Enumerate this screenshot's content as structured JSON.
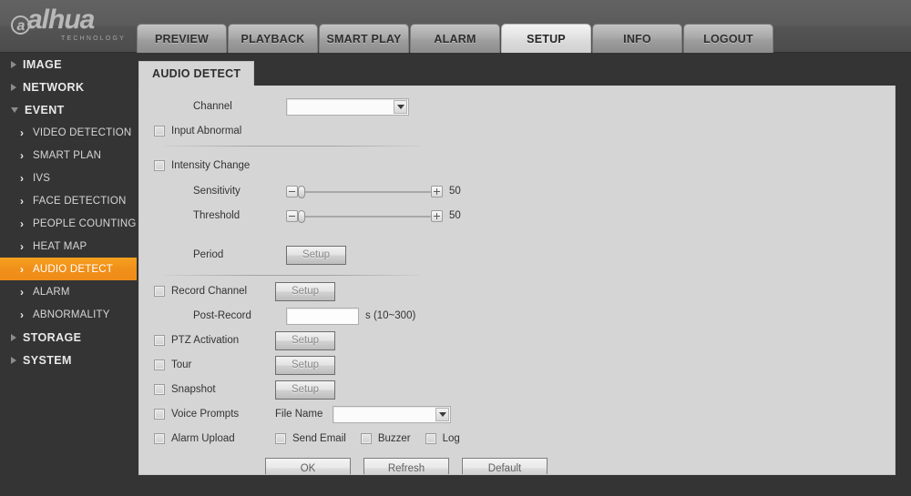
{
  "brand": {
    "name": "alhua",
    "tagline": "TECHNOLOGY"
  },
  "nav": {
    "tabs": [
      {
        "label": "PREVIEW",
        "active": false
      },
      {
        "label": "PLAYBACK",
        "active": false
      },
      {
        "label": "SMART PLAY",
        "active": false
      },
      {
        "label": "ALARM",
        "active": false
      },
      {
        "label": "SETUP",
        "active": true
      },
      {
        "label": "INFO",
        "active": false
      },
      {
        "label": "LOGOUT",
        "active": false
      }
    ]
  },
  "sidebar": {
    "items": [
      {
        "label": "IMAGE",
        "level": "top",
        "expanded": false,
        "selected": false
      },
      {
        "label": "NETWORK",
        "level": "top",
        "expanded": false,
        "selected": false
      },
      {
        "label": "EVENT",
        "level": "top",
        "expanded": true,
        "selected": false
      },
      {
        "label": "VIDEO DETECTION",
        "level": "sub",
        "selected": false
      },
      {
        "label": "SMART PLAN",
        "level": "sub",
        "selected": false
      },
      {
        "label": "IVS",
        "level": "sub",
        "selected": false
      },
      {
        "label": "FACE DETECTION",
        "level": "sub",
        "selected": false
      },
      {
        "label": "PEOPLE COUNTING",
        "level": "sub",
        "selected": false
      },
      {
        "label": "HEAT MAP",
        "level": "sub",
        "selected": false
      },
      {
        "label": "AUDIO DETECT",
        "level": "sub",
        "selected": true
      },
      {
        "label": "ALARM",
        "level": "sub",
        "selected": false
      },
      {
        "label": "ABNORMALITY",
        "level": "sub",
        "selected": false
      },
      {
        "label": "STORAGE",
        "level": "top",
        "expanded": false,
        "selected": false
      },
      {
        "label": "SYSTEM",
        "level": "top",
        "expanded": false,
        "selected": false
      }
    ],
    "selected_color": "#f0901a"
  },
  "panel": {
    "tab_label": "AUDIO DETECT",
    "channel": {
      "label": "Channel",
      "value": "",
      "options": []
    },
    "input_abnormal": {
      "label": "Input Abnormal",
      "checked": false
    },
    "intensity_change": {
      "label": "Intensity Change",
      "checked": false
    },
    "sensitivity": {
      "label": "Sensitivity",
      "value": "50",
      "min": "0",
      "max": "100"
    },
    "threshold": {
      "label": "Threshold",
      "value": "50",
      "min": "0",
      "max": "100"
    },
    "period": {
      "label": "Period",
      "button": "Setup"
    },
    "record_channel": {
      "label": "Record Channel",
      "checked": false,
      "button": "Setup"
    },
    "post_record": {
      "label": "Post-Record",
      "value": "",
      "hint": "s (10~300)"
    },
    "ptz_activation": {
      "label": "PTZ Activation",
      "checked": false,
      "button": "Setup"
    },
    "tour": {
      "label": "Tour",
      "checked": false,
      "button": "Setup"
    },
    "snapshot": {
      "label": "Snapshot",
      "checked": false,
      "button": "Setup"
    },
    "voice_prompts": {
      "label": "Voice Prompts",
      "checked": false,
      "file_name_label": "File Name",
      "file_name_value": "",
      "options": []
    },
    "alarm_upload": {
      "label": "Alarm Upload",
      "checked": false,
      "send_email": {
        "label": "Send Email",
        "checked": false
      },
      "buzzer": {
        "label": "Buzzer",
        "checked": false
      },
      "log": {
        "label": "Log",
        "checked": false
      }
    },
    "buttons": {
      "ok": "OK",
      "refresh": "Refresh",
      "default": "Default"
    }
  }
}
